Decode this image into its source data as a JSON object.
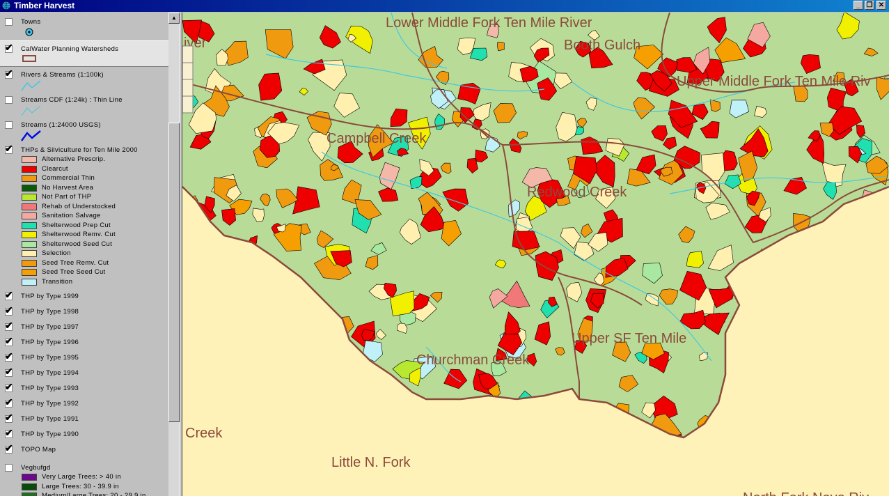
{
  "window": {
    "title": "Timber Harvest"
  },
  "legend": {
    "towns": {
      "label": "Towns",
      "checked": false
    },
    "calwater": {
      "label": "CalWater Planning Watersheds",
      "checked": true
    },
    "rivers": {
      "label": "Rivers & Streams (1:100k)",
      "checked": true
    },
    "streams_cdf": {
      "label": "Streams CDF (1:24k) : Thin Line",
      "checked": false
    },
    "streams_usgs": {
      "label": "Streams (1:24000 USGS)",
      "checked": false
    },
    "thps": {
      "label": "THPs & Silviculture for Ten Mile 2000",
      "checked": true,
      "classes": [
        {
          "label": "Alternative Prescrip.",
          "color": "#f4b8a8"
        },
        {
          "label": "Clearcut",
          "color": "#ee0000"
        },
        {
          "label": "Commercial Thin",
          "color": "#f09a10"
        },
        {
          "label": "No Harvest Area",
          "color": "#0a5a0a"
        },
        {
          "label": "Not Part of THP",
          "color": "#b8e830"
        },
        {
          "label": "Rehab of Understocked",
          "color": "#f07878"
        },
        {
          "label": "Sanitation Salvage",
          "color": "#f5a8a0"
        },
        {
          "label": "Shelterwood Prep Cut",
          "color": "#20e0b0"
        },
        {
          "label": "Shelterwood Remv. Cut",
          "color": "#f0f000"
        },
        {
          "label": "Shelterwood Seed Cut",
          "color": "#a8e8a0"
        },
        {
          "label": "Selection",
          "color": "#fff0b0"
        },
        {
          "label": "Seed Tree Remv. Cut",
          "color": "#f09a10"
        },
        {
          "label": "Seed Tree Seed Cut",
          "color": "#f5a000"
        },
        {
          "label": "Transition",
          "color": "#c0f0f8"
        }
      ]
    },
    "years": [
      {
        "label": "THP by Type 1999",
        "checked": true
      },
      {
        "label": "THP by Type 1998",
        "checked": true
      },
      {
        "label": "THP by Type 1997",
        "checked": true
      },
      {
        "label": "THP by Type 1996",
        "checked": true
      },
      {
        "label": "THP by Type 1995",
        "checked": true
      },
      {
        "label": "THP by Type 1994",
        "checked": true
      },
      {
        "label": "THP by Type 1993",
        "checked": true
      },
      {
        "label": "THP by Type 1992",
        "checked": true
      },
      {
        "label": "THP by Type 1991",
        "checked": true
      },
      {
        "label": "THP by Type 1990",
        "checked": true
      }
    ],
    "topo": {
      "label": "TOPO Map",
      "checked": true
    },
    "vegbufgd": {
      "label": "Vegbufgd",
      "checked": false,
      "classes": [
        {
          "label": "Very Large Trees: > 40  in",
          "color": "#6a0a8a"
        },
        {
          "label": "Large Trees: 30 - 39.9 in",
          "color": "#0a4a0a"
        },
        {
          "label": "Medium/Large Trees: 20 - 29.9 in",
          "color": "#207020"
        }
      ]
    }
  },
  "map": {
    "labels": [
      {
        "text": "Lower Middle Fork Ten Mile River"
      },
      {
        "text": "Booth Gulch"
      },
      {
        "text": "Upper Middle Fork Ten Mile Riv"
      },
      {
        "text": "Campbell Creek"
      },
      {
        "text": "Redwood Creek"
      },
      {
        "text": "Upper SF Ten Mile"
      },
      {
        "text": "Churchman Creek"
      },
      {
        "text": "Creek"
      },
      {
        "text": "Little N. Fork"
      },
      {
        "text": "iver"
      },
      {
        "text": "North Fork Noyo Riv"
      }
    ],
    "colors": {
      "background": "#fff2b8",
      "forest": "#b8dc98",
      "boundary": "#8b4a3a",
      "stream": "#40c8e0"
    }
  }
}
